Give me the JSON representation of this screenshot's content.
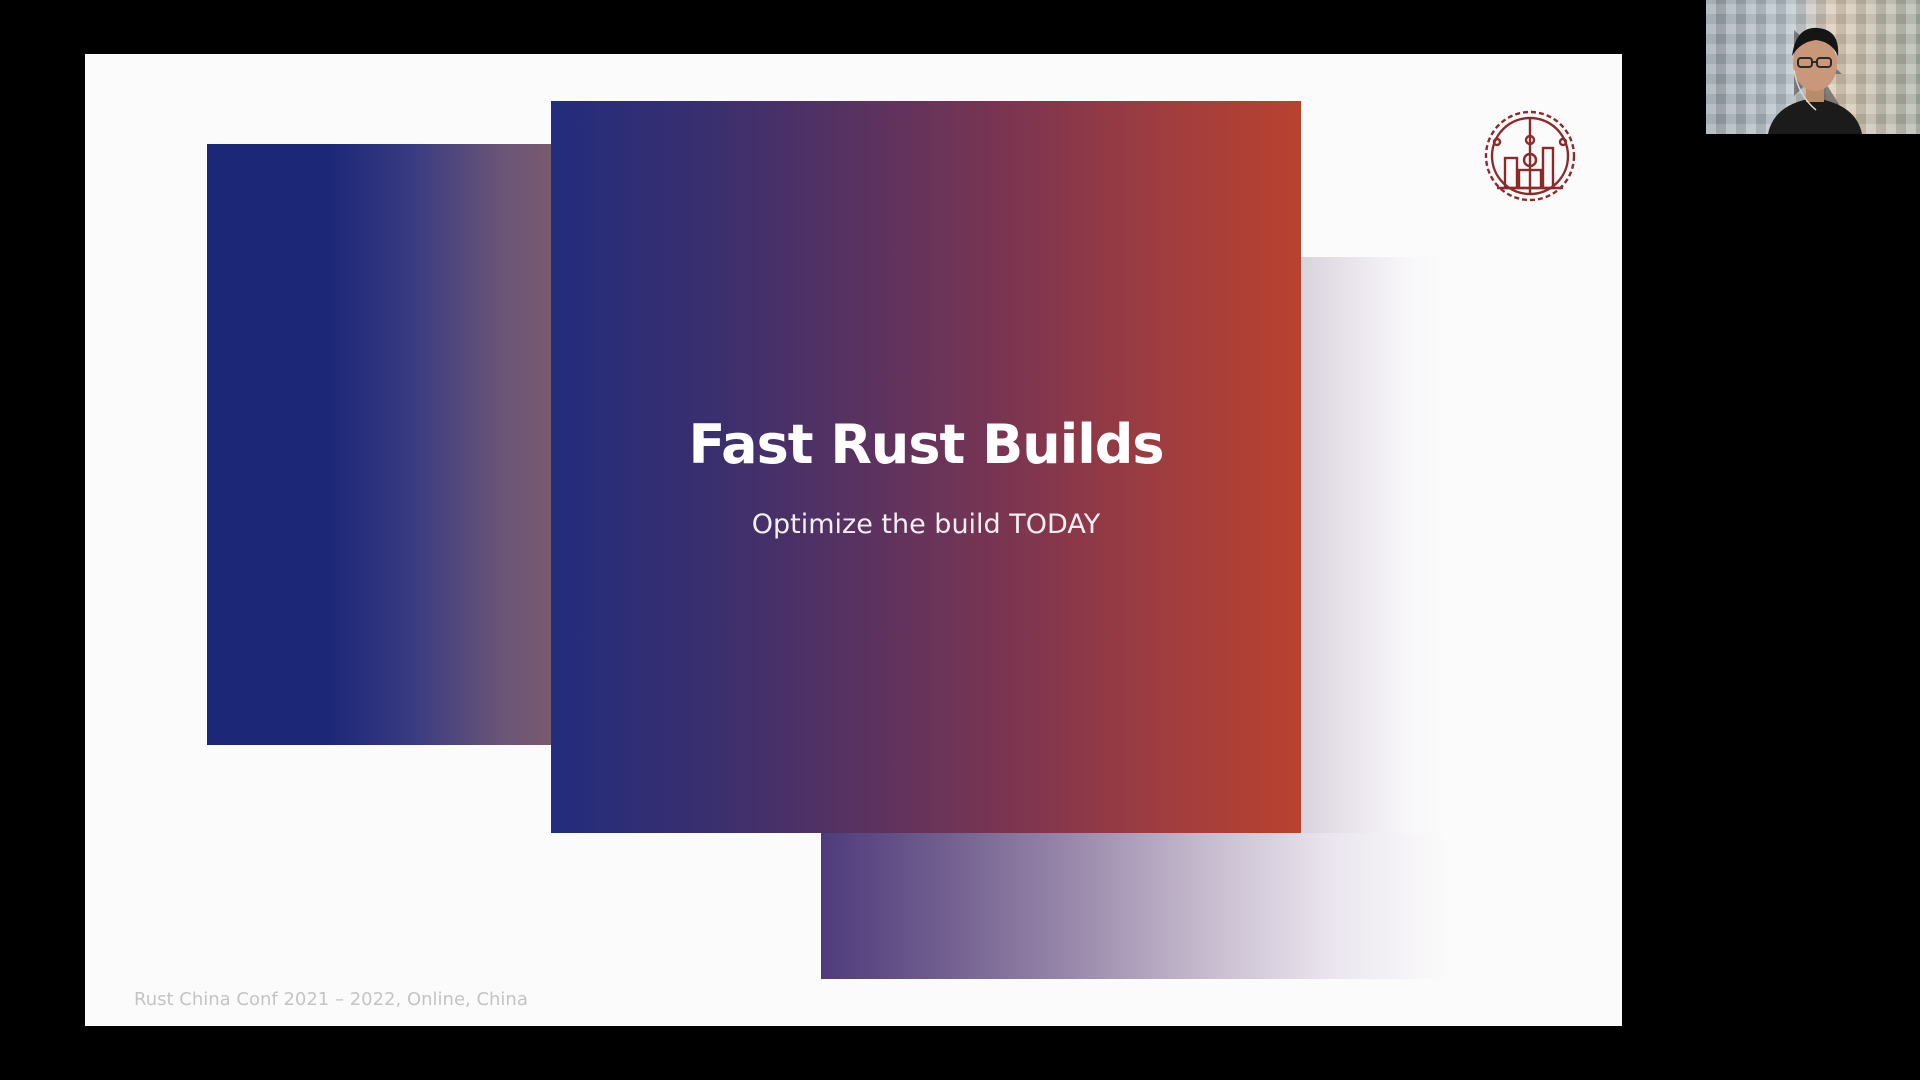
{
  "slide": {
    "title": "Fast Rust Builds",
    "subtitle": "Optimize the build TODAY",
    "footer": "Rust China Conf 2021 – 2022, Online, China"
  },
  "logo": {
    "icon": "rust-china-conf-gear-logo-icon",
    "color": "#8b2a2a"
  },
  "webcam": {
    "icon": "presenter-webcam"
  },
  "colors": {
    "gradient_start": "#232c7d",
    "gradient_end": "#b9422f",
    "background": "#000000",
    "slide_background": "#fbfbfb"
  }
}
